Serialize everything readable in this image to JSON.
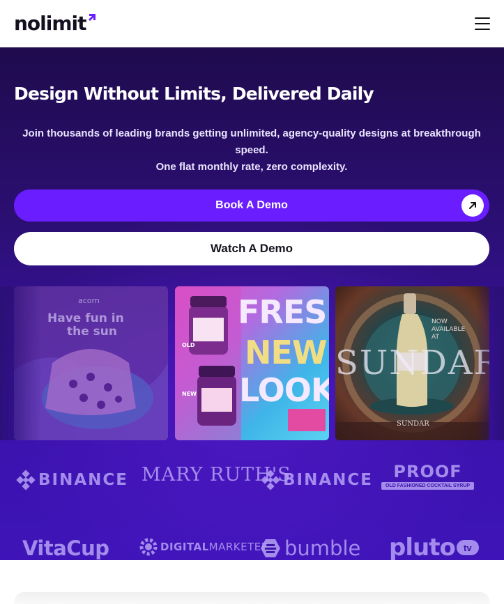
{
  "header": {
    "logo_text": "nolimit",
    "menu_icon": "hamburger-menu-icon"
  },
  "hero": {
    "title": "Design Without Limits, Delivered Daily",
    "subtitle_line1": "Join thousands of leading brands getting unlimited, agency-quality designs at breakthrough speed.",
    "subtitle_line2": "One flat monthly rate, zero complexity.",
    "primary_button": "Book A Demo",
    "secondary_button": "Watch A Demo"
  },
  "cards": {
    "card1": {
      "brand": "acorn",
      "headline_1": "Have fun in",
      "headline_2": "the sun"
    },
    "card2": {
      "word1": "FRESH",
      "word2": "NEW",
      "word3": "LOOK",
      "label_old": "OLD",
      "label_new": "NEW"
    },
    "card3": {
      "wordmark": "SUNDAR",
      "now": "NOW",
      "available": "AVAILABLE",
      "at": "AT",
      "footer": "SUNDAR"
    }
  },
  "brands": [
    "BINANCE",
    "MARY RUTH'S",
    "BINANCE",
    "PROOF",
    "VitaCup",
    "DIGITALMARKETER",
    "bumble",
    "pluto"
  ],
  "brand_extras": {
    "proof_sub": "OLD FASHIONED COCKTAIL SYRUP",
    "pluto_badge": "tv",
    "digital_prefix": "DIGITAL",
    "digital_suffix": "MARKETER"
  },
  "colors": {
    "accent": "#6a1eff",
    "hero_dark": "#1f0b4d",
    "hero_light": "#3e14b8",
    "logo_purple": "#6a1eff"
  }
}
